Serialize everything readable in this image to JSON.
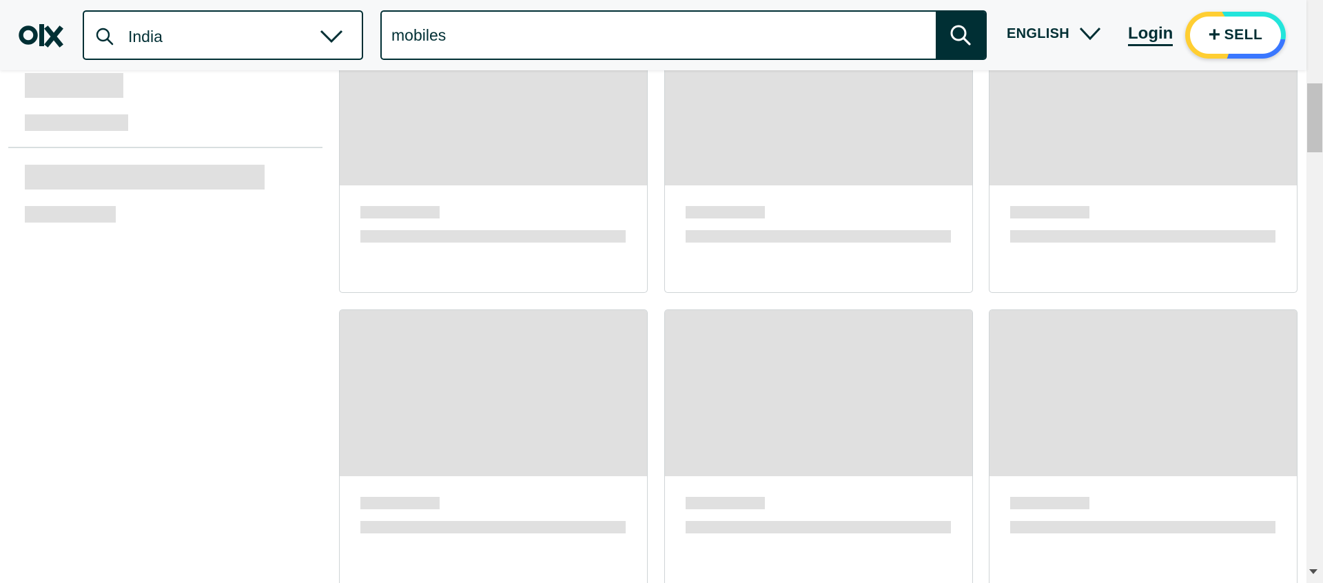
{
  "header": {
    "logo": "olx-logo",
    "location": {
      "value": "India",
      "icon": "search-icon"
    },
    "search": {
      "value": "mobiles",
      "button_icon": "search-icon"
    },
    "language": {
      "label": "ENGLISH"
    },
    "login": {
      "label": "Login"
    },
    "sell": {
      "plus": "+",
      "label": "SELL"
    }
  },
  "colors": {
    "primary": "#002f34",
    "header_bg": "#f7f8f9",
    "skeleton": "#e0e0e0",
    "sell_ring": [
      "#23e5db",
      "#3a77ff",
      "#ffce32"
    ]
  },
  "listing": {
    "state": "loading"
  }
}
